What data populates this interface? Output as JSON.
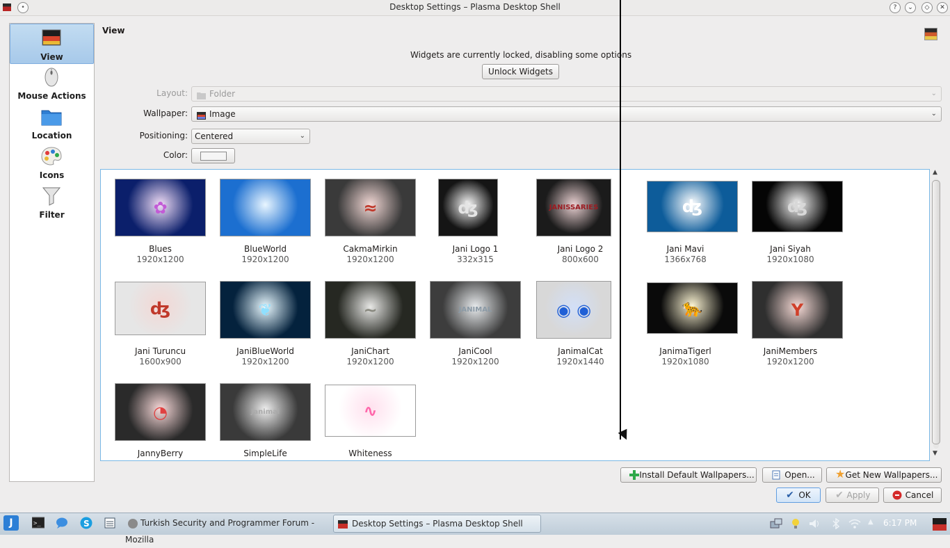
{
  "window": {
    "title": "Desktop Settings – Plasma Desktop Shell",
    "pin_glyph": "•",
    "buttons": [
      {
        "name": "help-button",
        "glyph": "?"
      },
      {
        "name": "minimize-button",
        "glyph": "⌄"
      },
      {
        "name": "maximize-button",
        "glyph": "◇"
      },
      {
        "name": "close-button",
        "glyph": "✕"
      }
    ]
  },
  "sidebar": {
    "items": [
      {
        "label": "View",
        "icon": "picture-icon"
      },
      {
        "label": "Mouse Actions",
        "icon": "mouse-icon"
      },
      {
        "label": "Location",
        "icon": "folder-icon"
      },
      {
        "label": "Icons",
        "icon": "palette-icon"
      },
      {
        "label": "Filter",
        "icon": "funnel-icon"
      }
    ]
  },
  "main": {
    "title": "View",
    "locked_message": "Widgets are currently locked, disabling some options",
    "unlock_label": "Unlock Widgets",
    "form": {
      "layout_label": "Layout:",
      "layout_value": "Folder",
      "wallpaper_label": "Wallpaper:",
      "wallpaper_value": "Image",
      "positioning_label": "Positioning:",
      "positioning_value": "Centered",
      "color_label": "Color:"
    }
  },
  "wallpapers": [
    {
      "name": "Blues",
      "res": "1920x1200",
      "bg": "#0b1f6b",
      "accent": "#c25bd6",
      "motif": "✿"
    },
    {
      "name": "BlueWorld",
      "res": "1920x1200",
      "bg": "#1c6fd0",
      "accent": "#8fd0ff",
      "motif": ""
    },
    {
      "name": "CakmaMirkin",
      "res": "1920x1200",
      "bg": "#3a3a3a",
      "accent": "#c0392b",
      "motif": "≈"
    },
    {
      "name": "Jani Logo 1",
      "res": "332x315",
      "bg": "#151515",
      "accent": "#e5e5e5",
      "motif": "ʤ"
    },
    {
      "name": "Jani Logo 2",
      "res": "800x600",
      "bg": "#1b1b1b",
      "accent": "#9c1c22",
      "motif": "JANISSARIES"
    },
    {
      "name": "Jani Mavi",
      "res": "1366x768",
      "bg": "#0d5c9a",
      "accent": "#ffffff",
      "motif": "ʤ"
    },
    {
      "name": "Jani Siyah",
      "res": "1920x1080",
      "bg": "#050505",
      "accent": "#d8d8d8",
      "motif": "ʤ"
    },
    {
      "name": "Jani Turuncu",
      "res": "1600x900",
      "bg": "#e6e6e6",
      "accent": "#c0392b",
      "motif": "ʤ"
    },
    {
      "name": "JaniBlueWorld",
      "res": "1920x1200",
      "bg": "#04223d",
      "accent": "#8fe0ff",
      "motif": "❦"
    },
    {
      "name": "JaniChart",
      "res": "1920x1200",
      "bg": "#262822",
      "accent": "#8a8a80",
      "motif": "~"
    },
    {
      "name": "JaniCool",
      "res": "1920x1200",
      "bg": "#3d3d3d",
      "accent": "#8b9aa6",
      "motif": "JANIMAL"
    },
    {
      "name": "JanimalCat",
      "res": "1920x1440",
      "bg": "#d8d8d8",
      "accent": "#1f5fd6",
      "motif": "◉ ◉"
    },
    {
      "name": "JanimaTigerl",
      "res": "1920x1080",
      "bg": "#0a0a0a",
      "accent": "#e8c21a",
      "motif": "🐆"
    },
    {
      "name": "JaniMembers",
      "res": "1920x1200",
      "bg": "#2f2f2f",
      "accent": "#d0402a",
      "motif": "Y"
    },
    {
      "name": "JannyBerry",
      "res": "1920x1200",
      "bg": "#2a2a2a",
      "accent": "#e04040",
      "motif": "◔"
    },
    {
      "name": "SimpleLife",
      "res": "1920x1200",
      "bg": "#3a3a3a",
      "accent": "#aaaaaa",
      "motif": "Janimal"
    },
    {
      "name": "Whiteness",
      "res": "1920x1200",
      "bg": "#ffffff",
      "accent": "#ff66aa",
      "motif": "∿"
    }
  ],
  "buttons": {
    "install_default": "Install Default Wallpapers...",
    "open": "Open...",
    "get_new": "Get New Wallpapers...",
    "ok": "OK",
    "apply": "Apply",
    "cancel": "Cancel"
  },
  "taskbar": {
    "launcher_glyph": "J",
    "tasks": [
      {
        "label": "Turkish Security and Programmer Forum - Mozilla"
      },
      {
        "label": "Desktop Settings – Plasma Desktop Shell"
      }
    ],
    "clock": "6:17 PM"
  },
  "colors": {
    "accent_blue": "#80aee0",
    "window_bg": "#eeeded",
    "taskbar": "#c9d6e1"
  }
}
